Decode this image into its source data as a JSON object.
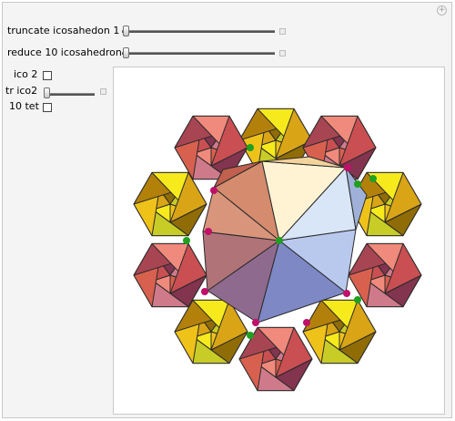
{
  "controls": {
    "truncate": {
      "label": "truncate icosahedon 1",
      "value": 0.04
    },
    "reduce": {
      "label": "reduce 10 icosahedron",
      "value": 0.04
    },
    "ico2": {
      "label": "ico 2",
      "checked": false
    },
    "tr_ico2": {
      "label": "tr ico2",
      "value": 0.05
    },
    "tet10": {
      "label": "10 tet",
      "checked": false
    }
  },
  "colors": {
    "panel_bg": "#f4f4f4",
    "plot_bg": "#ffffff",
    "green_dot": "#1fa01f",
    "magenta_dot": "#c0106a",
    "edge": "#2a2a2a"
  },
  "icons": [
    "plus-icon"
  ]
}
